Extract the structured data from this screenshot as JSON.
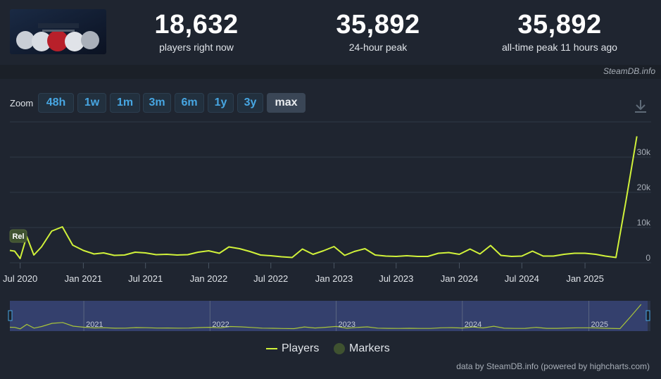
{
  "header": {
    "game_image_alt": "Star Wars Battlefront II",
    "stats": [
      {
        "value": "18,632",
        "label": "players right now"
      },
      {
        "value": "35,892",
        "label": "24-hour peak"
      },
      {
        "value": "35,892",
        "label": "all-time peak 11 hours ago"
      }
    ],
    "credit": "SteamDB.info"
  },
  "zoom": {
    "label": "Zoom",
    "buttons": [
      "48h",
      "1w",
      "1m",
      "3m",
      "6m",
      "1y",
      "3y",
      "max"
    ],
    "active": "max"
  },
  "chart_data": {
    "type": "line",
    "series": [
      {
        "name": "Players",
        "color": "#d1f23a",
        "points": [
          [
            "2020-06-01",
            3500
          ],
          [
            "2020-06-15",
            3300
          ],
          [
            "2020-07-01",
            1200
          ],
          [
            "2020-07-20",
            7500
          ],
          [
            "2020-08-10",
            2200
          ],
          [
            "2020-09-01",
            4500
          ],
          [
            "2020-10-01",
            9000
          ],
          [
            "2020-11-01",
            10200
          ],
          [
            "2020-12-01",
            5000
          ],
          [
            "2021-01-01",
            3500
          ],
          [
            "2021-02-01",
            2500
          ],
          [
            "2021-03-01",
            2800
          ],
          [
            "2021-04-01",
            2100
          ],
          [
            "2021-05-01",
            2200
          ],
          [
            "2021-06-01",
            3000
          ],
          [
            "2021-07-01",
            2800
          ],
          [
            "2021-08-01",
            2300
          ],
          [
            "2021-09-01",
            2400
          ],
          [
            "2021-10-01",
            2200
          ],
          [
            "2021-11-01",
            2300
          ],
          [
            "2021-12-01",
            3000
          ],
          [
            "2022-01-01",
            3400
          ],
          [
            "2022-02-01",
            2700
          ],
          [
            "2022-03-01",
            4500
          ],
          [
            "2022-04-01",
            4000
          ],
          [
            "2022-05-01",
            3200
          ],
          [
            "2022-06-01",
            2200
          ],
          [
            "2022-07-01",
            2000
          ],
          [
            "2022-08-01",
            1700
          ],
          [
            "2022-09-01",
            1500
          ],
          [
            "2022-10-01",
            3900
          ],
          [
            "2022-11-01",
            2400
          ],
          [
            "2022-12-01",
            3400
          ],
          [
            "2023-01-01",
            4600
          ],
          [
            "2023-02-01",
            2100
          ],
          [
            "2023-03-01",
            3200
          ],
          [
            "2023-04-01",
            4000
          ],
          [
            "2023-05-01",
            2200
          ],
          [
            "2023-06-01",
            1900
          ],
          [
            "2023-07-01",
            1800
          ],
          [
            "2023-08-01",
            2000
          ],
          [
            "2023-09-01",
            1800
          ],
          [
            "2023-10-01",
            1800
          ],
          [
            "2023-11-01",
            2700
          ],
          [
            "2023-12-01",
            2900
          ],
          [
            "2024-01-01",
            2400
          ],
          [
            "2024-02-01",
            3900
          ],
          [
            "2024-03-01",
            2500
          ],
          [
            "2024-04-01",
            4900
          ],
          [
            "2024-05-01",
            2100
          ],
          [
            "2024-06-01",
            1800
          ],
          [
            "2024-07-01",
            1900
          ],
          [
            "2024-08-01",
            3300
          ],
          [
            "2024-09-01",
            1900
          ],
          [
            "2024-10-01",
            1900
          ],
          [
            "2024-11-01",
            2400
          ],
          [
            "2024-12-01",
            2700
          ],
          [
            "2025-01-01",
            2700
          ],
          [
            "2025-02-01",
            2400
          ],
          [
            "2025-03-01",
            1900
          ],
          [
            "2025-04-01",
            1500
          ],
          [
            "2025-05-01",
            18000
          ],
          [
            "2025-06-01",
            35892
          ]
        ]
      }
    ],
    "ylim": [
      0,
      38000
    ],
    "yticks": [
      0,
      10000,
      20000,
      30000
    ],
    "ytick_labels": [
      "0",
      "10k",
      "20k",
      "30k"
    ],
    "xticks": [
      "2020-07-01",
      "2021-01-01",
      "2021-07-01",
      "2022-01-01",
      "2022-07-01",
      "2023-01-01",
      "2023-07-01",
      "2024-01-01",
      "2024-07-01",
      "2025-01-01"
    ],
    "xtick_labels": [
      "Jul 2020",
      "Jan 2021",
      "Jul 2021",
      "Jan 2022",
      "Jul 2022",
      "Jan 2023",
      "Jul 2023",
      "Jan 2024",
      "Jul 2024",
      "Jan 2025"
    ],
    "xlim": [
      "2020-06-01",
      "2025-06-20"
    ],
    "navigator_labels": [
      "2021",
      "2022",
      "2023",
      "2024",
      "2025"
    ],
    "flag": {
      "date": "2020-06-01",
      "text": "Rel"
    },
    "grid": true,
    "legend": [
      {
        "name": "Players",
        "color": "#d1f23a",
        "symbol": "line"
      },
      {
        "name": "Markers",
        "color": "#3f5230",
        "symbol": "circle"
      }
    ],
    "legend_position": "bottom-center"
  },
  "footer": {
    "credit": "data by SteamDB.info (powered by highcharts.com)"
  }
}
